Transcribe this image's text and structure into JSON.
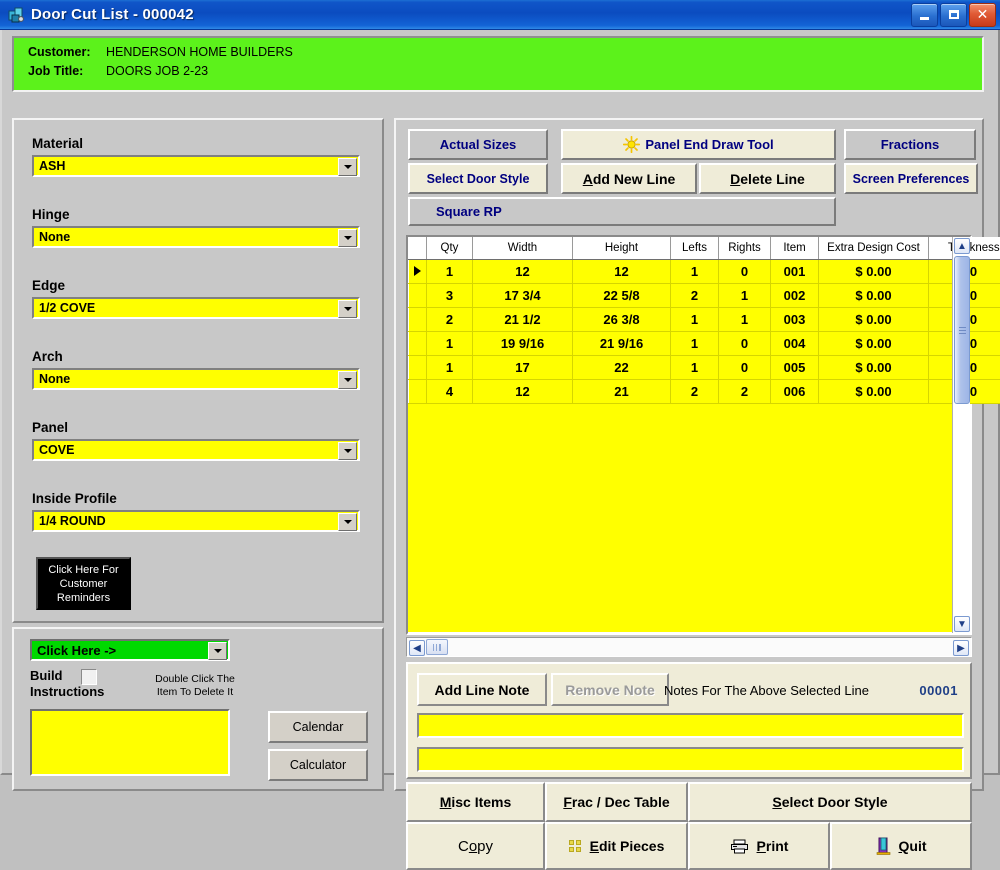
{
  "window": {
    "title": "Door Cut List - 000042",
    "icon": "app-icon",
    "minimize": "_",
    "maximize": "□",
    "close": "✕"
  },
  "header": {
    "customer_label": "Customer:",
    "customer_value": "HENDERSON HOME BUILDERS",
    "job_title_label": "Job Title:",
    "job_title_value": "DOORS JOB 2-23",
    "background_color": "#5cf21b"
  },
  "left_panel": {
    "fields": [
      {
        "label": "Material",
        "value": "ASH"
      },
      {
        "label": "Hinge",
        "value": "None"
      },
      {
        "label": "Edge",
        "value": "1/2 COVE"
      },
      {
        "label": "Arch",
        "value": "None"
      },
      {
        "label": "Panel",
        "value": "COVE"
      },
      {
        "label": "Inside Profile",
        "value": "1/4 ROUND"
      }
    ],
    "reminders_button": [
      "Click Here For",
      "Customer",
      "Reminders"
    ]
  },
  "left_bottom": {
    "green_combo_value": "Click Here ->",
    "build_label_line1": "Build",
    "build_label_line2": "Instructions",
    "build_checked": false,
    "hint_line1": "Double Click The",
    "hint_line2": "Item To Delete It",
    "build_box_value": "",
    "calendar_button": "Calendar",
    "calculator_button": "Calculator"
  },
  "toolbar": {
    "actual_sizes": "Actual Sizes",
    "panel_end_draw_tool": "Panel End Draw Tool",
    "fractions": "Fractions",
    "select_door_style": "Select Door Style",
    "add_new_line": "Add New Line",
    "add_new_line_accel": "A",
    "delete_line": "Delete Line",
    "delete_line_accel": "D",
    "screen_preferences": "Screen Preferences",
    "door_style_row": "Square RP"
  },
  "grid": {
    "columns": [
      "Qty",
      "Width",
      "Height",
      "Lefts",
      "Rights",
      "Item",
      "Extra Design Cost",
      "Thickness"
    ],
    "selected_row_index": 0,
    "rows": [
      {
        "qty": "1",
        "width": "12",
        "height": "12",
        "lefts": "1",
        "rights": "0",
        "item": "001",
        "extra_design_cost": "$ 0.00",
        "thickness": "0"
      },
      {
        "qty": "3",
        "width": "17 3/4",
        "height": "22 5/8",
        "lefts": "2",
        "rights": "1",
        "item": "002",
        "extra_design_cost": "$ 0.00",
        "thickness": "0"
      },
      {
        "qty": "2",
        "width": "21 1/2",
        "height": "26 3/8",
        "lefts": "1",
        "rights": "1",
        "item": "003",
        "extra_design_cost": "$ 0.00",
        "thickness": "0"
      },
      {
        "qty": "1",
        "width": "19 9/16",
        "height": "21 9/16",
        "lefts": "1",
        "rights": "0",
        "item": "004",
        "extra_design_cost": "$ 0.00",
        "thickness": "0"
      },
      {
        "qty": "1",
        "width": "17",
        "height": "22",
        "lefts": "1",
        "rights": "0",
        "item": "005",
        "extra_design_cost": "$ 0.00",
        "thickness": "0"
      },
      {
        "qty": "4",
        "width": "12",
        "height": "21",
        "lefts": "2",
        "rights": "2",
        "item": "006",
        "extra_design_cost": "$ 0.00",
        "thickness": "0"
      }
    ]
  },
  "notes": {
    "add_line_note": "Add Line Note",
    "remove_note": "Remove Note",
    "remove_note_disabled": true,
    "caption": "Notes For The Above Selected Line",
    "line_number": "00001",
    "note_1": "",
    "note_2": ""
  },
  "bottom_bar": {
    "misc_items": "Misc Items",
    "misc_items_accel": "M",
    "frac_dec_table": "Frac / Dec Table",
    "frac_dec_table_accel": "F",
    "select_door_style": "Select Door Style",
    "select_door_style_accel": "S",
    "copy": "Copy",
    "copy_accel": "o",
    "edit_pieces": "Edit Pieces",
    "edit_pieces_accel": "E",
    "print": "Print",
    "print_accel": "P",
    "quit": "Quit",
    "quit_accel": "Q"
  },
  "colors": {
    "title_blue": "#0b4cc0",
    "field_yellow": "#ffff00",
    "header_green": "#5cf21b",
    "button_navy": "#000080",
    "face_gray": "#c8c8c8",
    "cream": "#efecd8"
  }
}
